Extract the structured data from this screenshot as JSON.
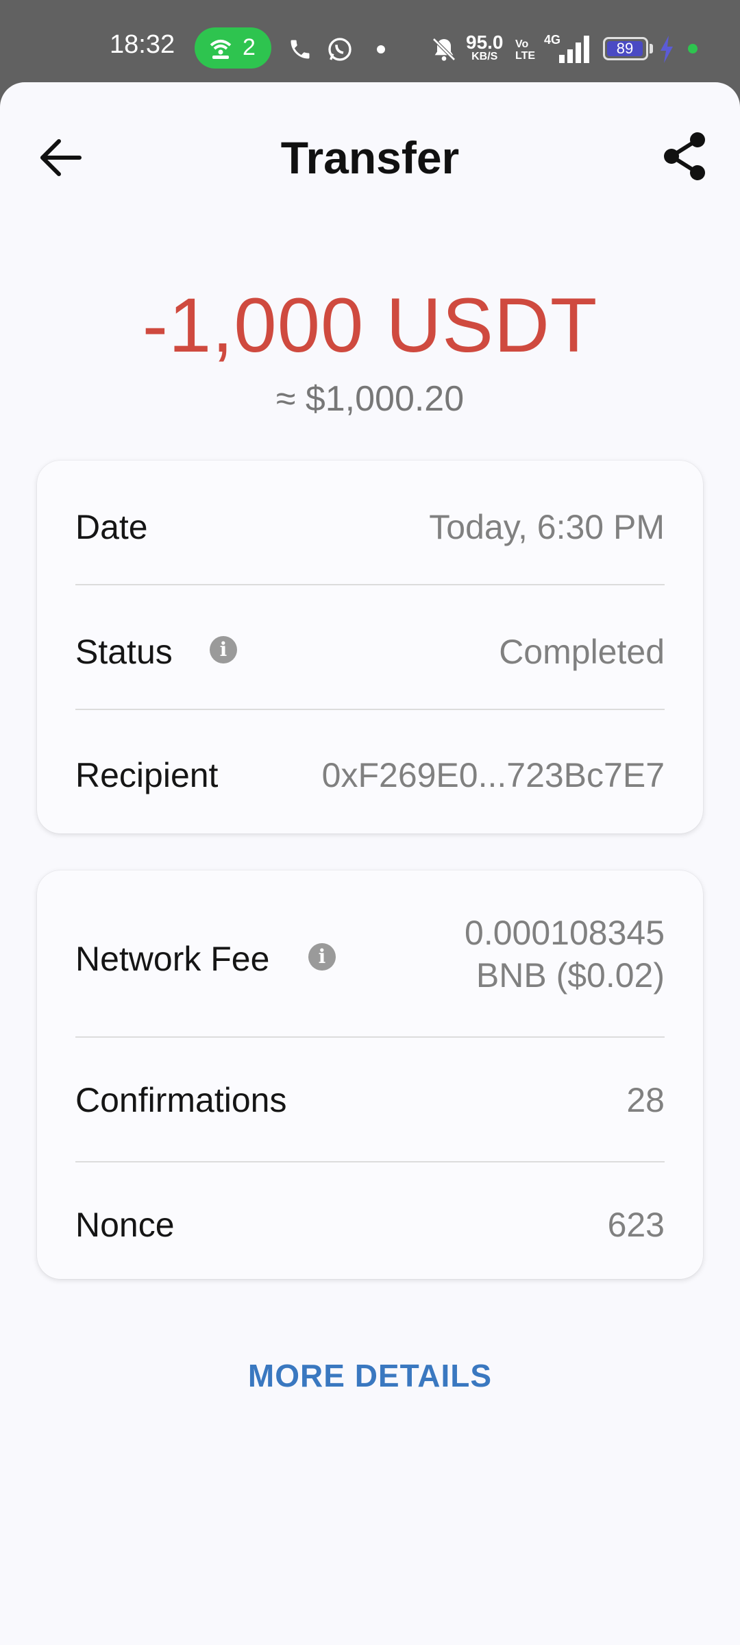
{
  "status_bar": {
    "time": "18:32",
    "pill_count": "2",
    "net_speed": "95.0",
    "net_speed_unit": "KB/S",
    "volte": "Vo\nLTE",
    "network": "4G",
    "battery": "89",
    "colors": {
      "pill": "#2ec44f",
      "battery": "#4a4ac4"
    }
  },
  "header": {
    "title": "Transfer",
    "back_icon": "arrow-left-icon",
    "share_icon": "share-icon"
  },
  "amount": {
    "value": "-1,000 USDT",
    "fiat": "≈ $1,000.20",
    "color": "#cf4a3f"
  },
  "details_card": {
    "rows": [
      {
        "label": "Date",
        "value": "Today, 6:30 PM"
      },
      {
        "label": "Status",
        "value": "Completed"
      },
      {
        "label": "Recipient",
        "value": "0xF269E0...723Bc7E7"
      }
    ]
  },
  "network_card": {
    "fee_label": "Network Fee",
    "fee_line1": "0.000108345",
    "fee_line2": "BNB ($0.02)",
    "rows": [
      {
        "label": "Confirmations",
        "value": "28"
      },
      {
        "label": "Nonce",
        "value": "623"
      }
    ]
  },
  "more_details": "MORE DETAILS"
}
